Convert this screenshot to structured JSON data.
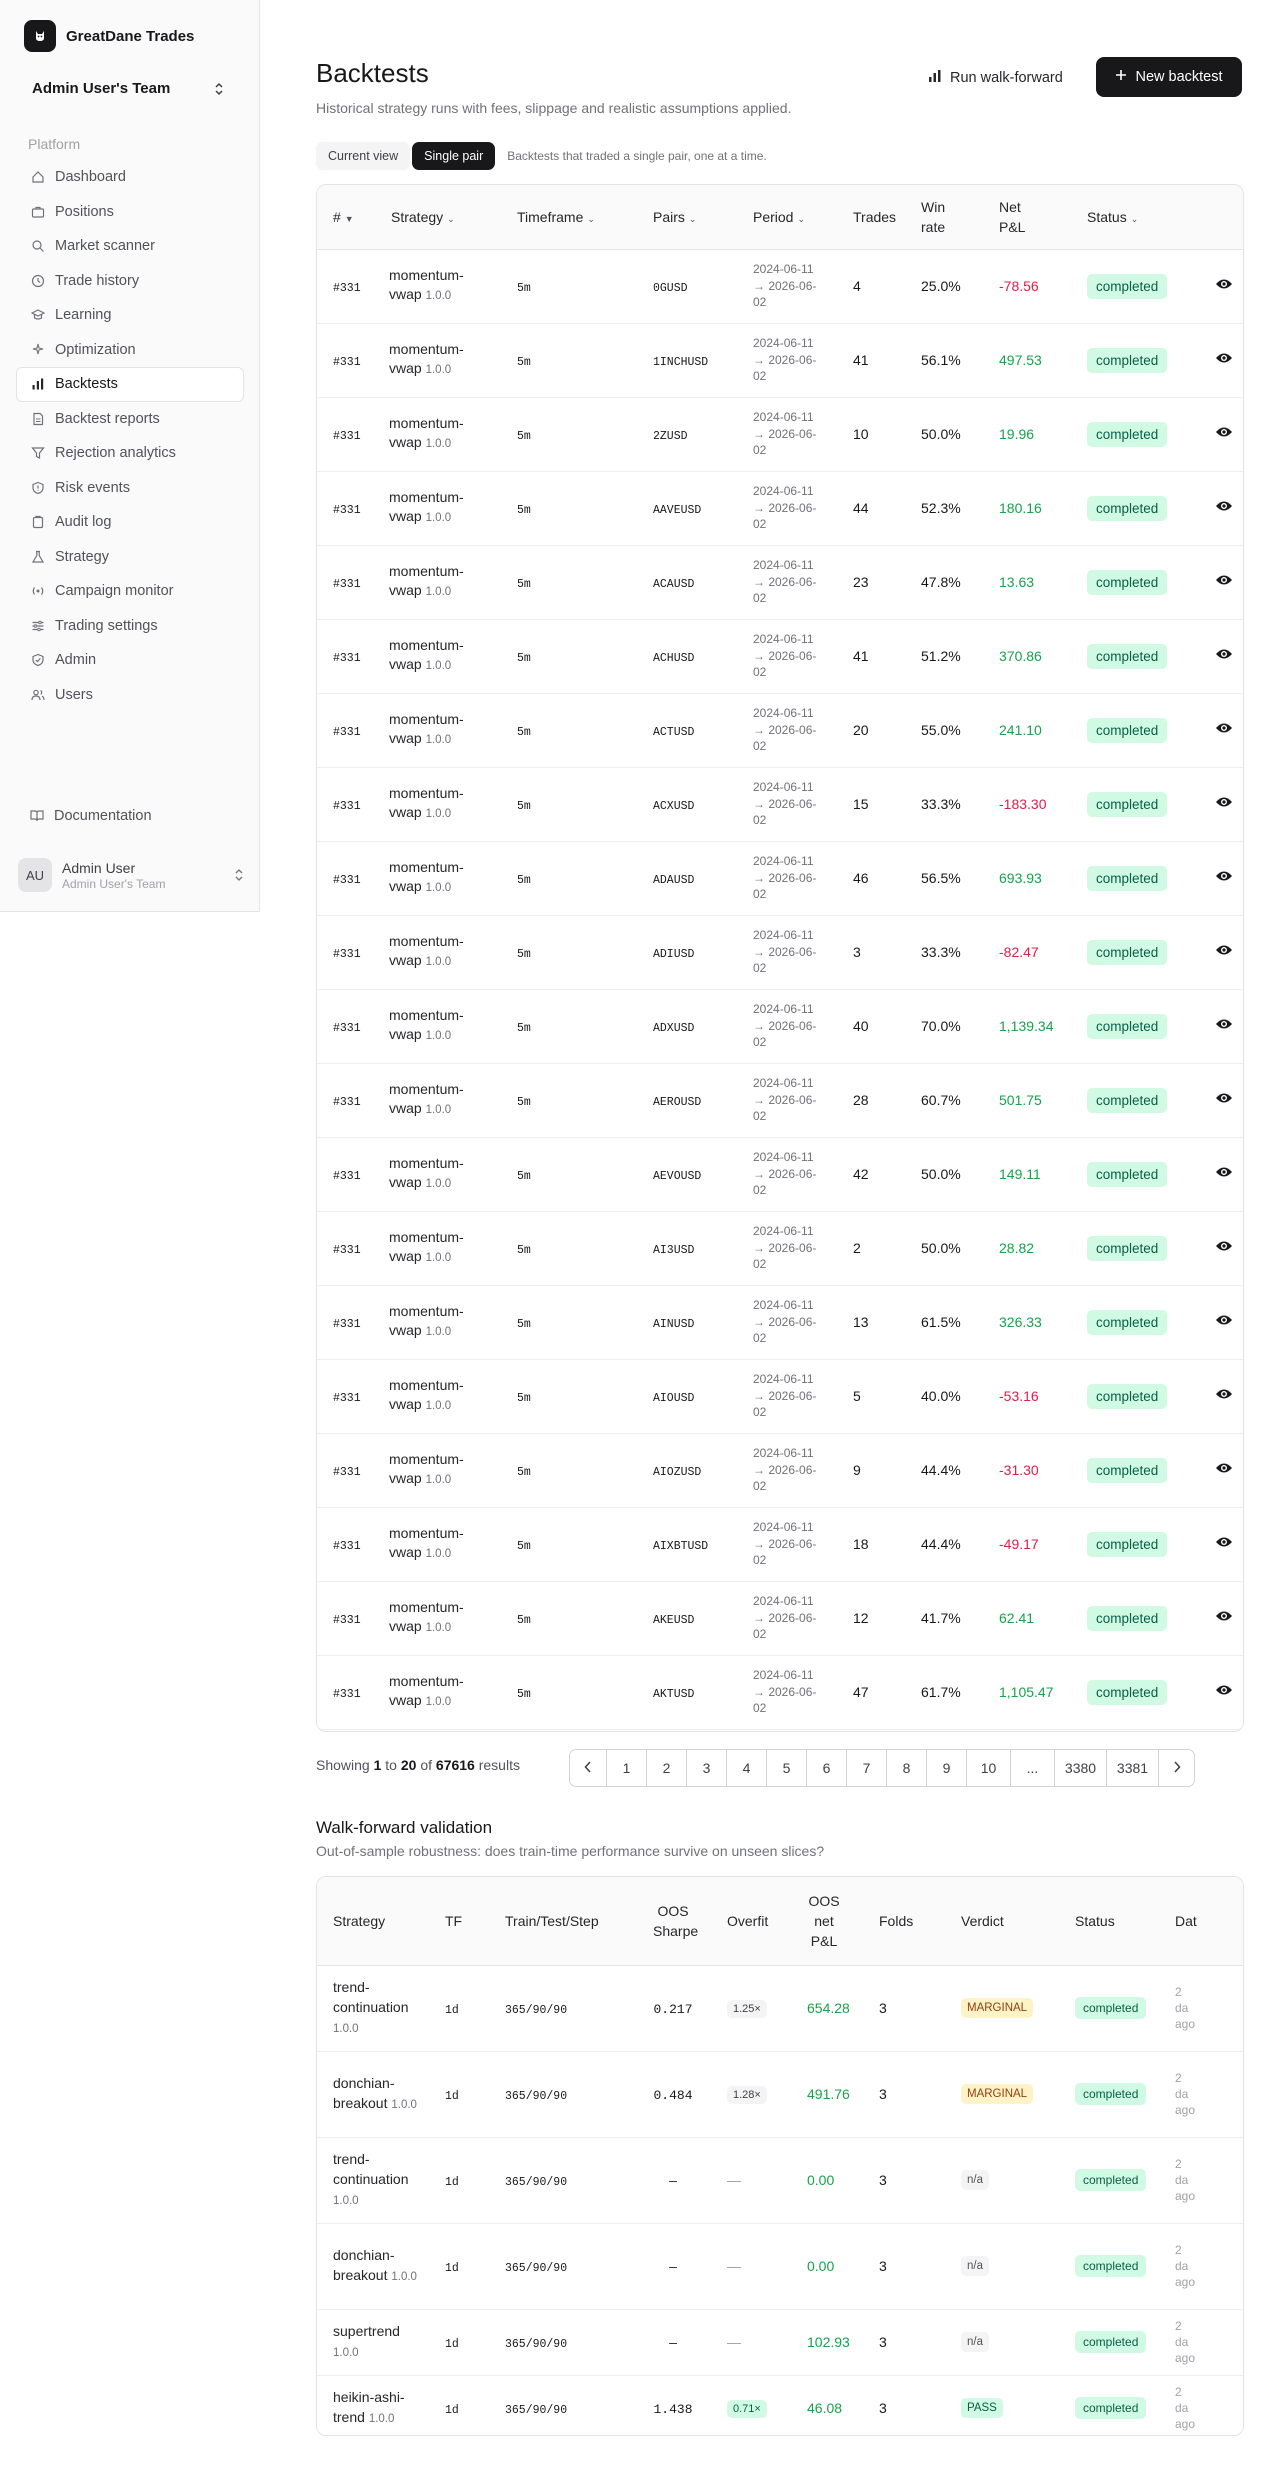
{
  "sidebar": {
    "brand": "GreatDane Trades",
    "team": "Admin User's Team",
    "section": "Platform",
    "items": [
      {
        "label": "Dashboard",
        "icon": "home-icon"
      },
      {
        "label": "Positions",
        "icon": "briefcase-icon"
      },
      {
        "label": "Market scanner",
        "icon": "search-icon"
      },
      {
        "label": "Trade history",
        "icon": "clock-icon"
      },
      {
        "label": "Learning",
        "icon": "graduation-cap-icon"
      },
      {
        "label": "Optimization",
        "icon": "sparkles-icon"
      },
      {
        "label": "Backtests",
        "icon": "bar-chart-icon",
        "active": true
      },
      {
        "label": "Backtest reports",
        "icon": "file-text-icon"
      },
      {
        "label": "Rejection analytics",
        "icon": "filter-icon"
      },
      {
        "label": "Risk events",
        "icon": "shield-alert-icon"
      },
      {
        "label": "Audit log",
        "icon": "clipboard-icon"
      },
      {
        "label": "Strategy",
        "icon": "flask-icon"
      },
      {
        "label": "Campaign monitor",
        "icon": "radio-icon"
      },
      {
        "label": "Trading settings",
        "icon": "sliders-icon"
      },
      {
        "label": "Admin",
        "icon": "shield-check-icon"
      },
      {
        "label": "Users",
        "icon": "users-icon"
      }
    ],
    "documentation": "Documentation",
    "user": {
      "initials": "AU",
      "name": "Admin User",
      "team": "Admin User's Team"
    }
  },
  "header": {
    "title": "Backtests",
    "subtitle": "Historical strategy runs with fees, slippage and realistic assumptions applied.",
    "walk_forward_label": "Run walk-forward",
    "new_backtest_label": "New backtest"
  },
  "tabs": {
    "current": "Current view",
    "single": "Single pair",
    "hint": "Backtests that traded a single pair, one at a time."
  },
  "backtests": {
    "columns": {
      "id": "#",
      "strategy": "Strategy",
      "timeframe": "Timeframe",
      "pairs": "Pairs",
      "period": "Period",
      "trades": "Trades",
      "winrate": "Win rate",
      "pnl": "Net P&L",
      "status": "Status"
    },
    "rows": [
      {
        "id": "#331",
        "strategy": "momentum-vwap",
        "version": "1.0.0",
        "tf": "5m",
        "pair": "0GUSD",
        "start": "2024-06-11",
        "end": "→ 2026-06-02",
        "trades": "4",
        "win": "25.0%",
        "pnl": "-78.56",
        "status": "completed"
      },
      {
        "id": "#331",
        "strategy": "momentum-vwap",
        "version": "1.0.0",
        "tf": "5m",
        "pair": "1INCHUSD",
        "start": "2024-06-11",
        "end": "→ 2026-06-02",
        "trades": "41",
        "win": "56.1%",
        "pnl": "497.53",
        "status": "completed"
      },
      {
        "id": "#331",
        "strategy": "momentum-vwap",
        "version": "1.0.0",
        "tf": "5m",
        "pair": "2ZUSD",
        "start": "2024-06-11",
        "end": "→ 2026-06-02",
        "trades": "10",
        "win": "50.0%",
        "pnl": "19.96",
        "status": "completed"
      },
      {
        "id": "#331",
        "strategy": "momentum-vwap",
        "version": "1.0.0",
        "tf": "5m",
        "pair": "AAVEUSD",
        "start": "2024-06-11",
        "end": "→ 2026-06-02",
        "trades": "44",
        "win": "52.3%",
        "pnl": "180.16",
        "status": "completed"
      },
      {
        "id": "#331",
        "strategy": "momentum-vwap",
        "version": "1.0.0",
        "tf": "5m",
        "pair": "ACAUSD",
        "start": "2024-06-11",
        "end": "→ 2026-06-02",
        "trades": "23",
        "win": "47.8%",
        "pnl": "13.63",
        "status": "completed"
      },
      {
        "id": "#331",
        "strategy": "momentum-vwap",
        "version": "1.0.0",
        "tf": "5m",
        "pair": "ACHUSD",
        "start": "2024-06-11",
        "end": "→ 2026-06-02",
        "trades": "41",
        "win": "51.2%",
        "pnl": "370.86",
        "status": "completed"
      },
      {
        "id": "#331",
        "strategy": "momentum-vwap",
        "version": "1.0.0",
        "tf": "5m",
        "pair": "ACTUSD",
        "start": "2024-06-11",
        "end": "→ 2026-06-02",
        "trades": "20",
        "win": "55.0%",
        "pnl": "241.10",
        "status": "completed"
      },
      {
        "id": "#331",
        "strategy": "momentum-vwap",
        "version": "1.0.0",
        "tf": "5m",
        "pair": "ACXUSD",
        "start": "2024-06-11",
        "end": "→ 2026-06-02",
        "trades": "15",
        "win": "33.3%",
        "pnl": "-183.30",
        "status": "completed"
      },
      {
        "id": "#331",
        "strategy": "momentum-vwap",
        "version": "1.0.0",
        "tf": "5m",
        "pair": "ADAUSD",
        "start": "2024-06-11",
        "end": "→ 2026-06-02",
        "trades": "46",
        "win": "56.5%",
        "pnl": "693.93",
        "status": "completed"
      },
      {
        "id": "#331",
        "strategy": "momentum-vwap",
        "version": "1.0.0",
        "tf": "5m",
        "pair": "ADIUSD",
        "start": "2024-06-11",
        "end": "→ 2026-06-02",
        "trades": "3",
        "win": "33.3%",
        "pnl": "-82.47",
        "status": "completed"
      },
      {
        "id": "#331",
        "strategy": "momentum-vwap",
        "version": "1.0.0",
        "tf": "5m",
        "pair": "ADXUSD",
        "start": "2024-06-11",
        "end": "→ 2026-06-02",
        "trades": "40",
        "win": "70.0%",
        "pnl": "1,139.34",
        "status": "completed"
      },
      {
        "id": "#331",
        "strategy": "momentum-vwap",
        "version": "1.0.0",
        "tf": "5m",
        "pair": "AEROUSD",
        "start": "2024-06-11",
        "end": "→ 2026-06-02",
        "trades": "28",
        "win": "60.7%",
        "pnl": "501.75",
        "status": "completed"
      },
      {
        "id": "#331",
        "strategy": "momentum-vwap",
        "version": "1.0.0",
        "tf": "5m",
        "pair": "AEVOUSD",
        "start": "2024-06-11",
        "end": "→ 2026-06-02",
        "trades": "42",
        "win": "50.0%",
        "pnl": "149.11",
        "status": "completed"
      },
      {
        "id": "#331",
        "strategy": "momentum-vwap",
        "version": "1.0.0",
        "tf": "5m",
        "pair": "AI3USD",
        "start": "2024-06-11",
        "end": "→ 2026-06-02",
        "trades": "2",
        "win": "50.0%",
        "pnl": "28.82",
        "status": "completed"
      },
      {
        "id": "#331",
        "strategy": "momentum-vwap",
        "version": "1.0.0",
        "tf": "5m",
        "pair": "AINUSD",
        "start": "2024-06-11",
        "end": "→ 2026-06-02",
        "trades": "13",
        "win": "61.5%",
        "pnl": "326.33",
        "status": "completed"
      },
      {
        "id": "#331",
        "strategy": "momentum-vwap",
        "version": "1.0.0",
        "tf": "5m",
        "pair": "AIOUSD",
        "start": "2024-06-11",
        "end": "→ 2026-06-02",
        "trades": "5",
        "win": "40.0%",
        "pnl": "-53.16",
        "status": "completed"
      },
      {
        "id": "#331",
        "strategy": "momentum-vwap",
        "version": "1.0.0",
        "tf": "5m",
        "pair": "AIOZUSD",
        "start": "2024-06-11",
        "end": "→ 2026-06-02",
        "trades": "9",
        "win": "44.4%",
        "pnl": "-31.30",
        "status": "completed"
      },
      {
        "id": "#331",
        "strategy": "momentum-vwap",
        "version": "1.0.0",
        "tf": "5m",
        "pair": "AIXBTUSD",
        "start": "2024-06-11",
        "end": "→ 2026-06-02",
        "trades": "18",
        "win": "44.4%",
        "pnl": "-49.17",
        "status": "completed"
      },
      {
        "id": "#331",
        "strategy": "momentum-vwap",
        "version": "1.0.0",
        "tf": "5m",
        "pair": "AKEUSD",
        "start": "2024-06-11",
        "end": "→ 2026-06-02",
        "trades": "12",
        "win": "41.7%",
        "pnl": "62.41",
        "status": "completed"
      },
      {
        "id": "#331",
        "strategy": "momentum-vwap",
        "version": "1.0.0",
        "tf": "5m",
        "pair": "AKTUSD",
        "start": "2024-06-11",
        "end": "→ 2026-06-02",
        "trades": "47",
        "win": "61.7%",
        "pnl": "1,105.47",
        "status": "completed"
      }
    ]
  },
  "pagination": {
    "showing_prefix": "Showing",
    "from": "1",
    "to_word": "to",
    "to": "20",
    "of_word": "of",
    "total": "67616",
    "results_word": "results",
    "pages": [
      "1",
      "2",
      "3",
      "4",
      "5",
      "6",
      "7",
      "8",
      "9",
      "10",
      "...",
      "3380",
      "3381"
    ]
  },
  "walk_forward": {
    "title": "Walk-forward validation",
    "subtitle": "Out-of-sample robustness: does train-time performance survive on unseen slices?",
    "columns": {
      "strategy": "Strategy",
      "tf": "TF",
      "tts": "Train/Test/Step",
      "sharpe": "OOS Sharpe",
      "overfit": "Overfit",
      "oos_pnl": "OOS net P&L",
      "folds": "Folds",
      "verdict": "Verdict",
      "status": "Status",
      "date": "Dat"
    },
    "rows": [
      {
        "strategy": "trend-continuation",
        "version": "1.0.0",
        "tf": "1d",
        "tts": "365/90/90",
        "sharpe": "0.217",
        "overfit": "1.25×",
        "overfit_good": false,
        "pnl": "654.28",
        "folds": "3",
        "verdict": "MARGINAL",
        "verdict_kind": "marg",
        "status": "completed",
        "date": "2 da ago"
      },
      {
        "strategy": "donchian-breakout",
        "version": "1.0.0",
        "tf": "1d",
        "tts": "365/90/90",
        "sharpe": "0.484",
        "overfit": "1.28×",
        "overfit_good": false,
        "pnl": "491.76",
        "folds": "3",
        "verdict": "MARGINAL",
        "verdict_kind": "marg",
        "status": "completed",
        "date": "2 da ago"
      },
      {
        "strategy": "trend-continuation",
        "version": "1.0.0",
        "tf": "1d",
        "tts": "365/90/90",
        "sharpe": "—",
        "overfit": "—",
        "overfit_good": null,
        "pnl": "0.00",
        "folds": "3",
        "verdict": "n/a",
        "verdict_kind": "na",
        "status": "completed",
        "date": "2 da ago"
      },
      {
        "strategy": "donchian-breakout",
        "version": "1.0.0",
        "tf": "1d",
        "tts": "365/90/90",
        "sharpe": "—",
        "overfit": "—",
        "overfit_good": null,
        "pnl": "0.00",
        "folds": "3",
        "verdict": "n/a",
        "verdict_kind": "na",
        "status": "completed",
        "date": "2 da ago"
      },
      {
        "strategy": "supertrend",
        "version": "1.0.0",
        "tf": "1d",
        "tts": "365/90/90",
        "sharpe": "—",
        "overfit": "—",
        "overfit_good": null,
        "pnl": "102.93",
        "folds": "3",
        "verdict": "n/a",
        "verdict_kind": "na",
        "status": "completed",
        "date": "2 da ago"
      },
      {
        "strategy": "heikin-ashi-trend",
        "version": "1.0.0",
        "tf": "1d",
        "tts": "365/90/90",
        "sharpe": "1.438",
        "overfit": "0.71×",
        "overfit_good": true,
        "pnl": "46.08",
        "folds": "3",
        "verdict": "PASS",
        "verdict_kind": "pass",
        "status": "completed",
        "date": "2 da ago"
      }
    ]
  },
  "colors": {
    "accent": "#18181b",
    "positive": "#16a34a",
    "negative": "#e11d48",
    "status_bg": "#d1fae5"
  }
}
